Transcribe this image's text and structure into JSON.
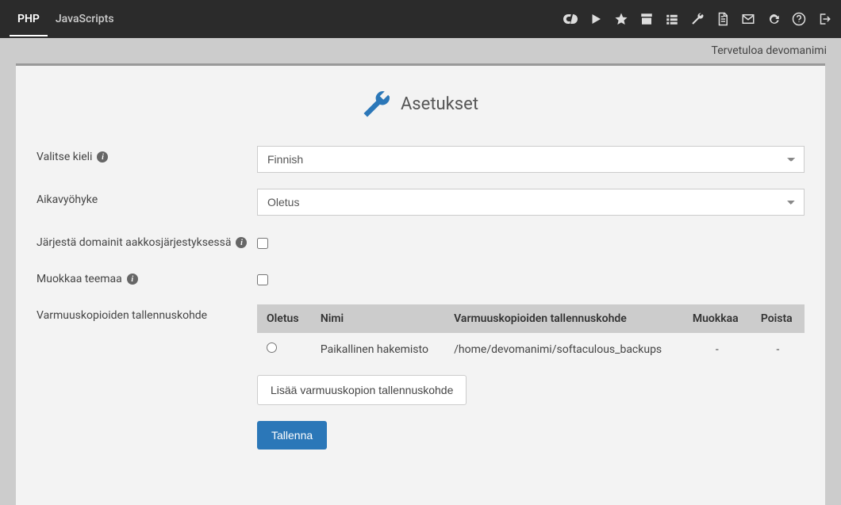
{
  "topbar": {
    "tabs": [
      {
        "label": "PHP",
        "active": true
      },
      {
        "label": "JavaScripts",
        "active": false
      }
    ]
  },
  "welcome": "Tervetuloa devomanimi",
  "page": {
    "title": "Asetukset"
  },
  "form": {
    "language_label": "Valitse kieli",
    "language_value": "Finnish",
    "timezone_label": "Aikavyöhyke",
    "timezone_value": "Oletus",
    "sort_domains_label": "Järjestä domainit aakkosjärjestyksessä",
    "sort_domains_checked": false,
    "edit_theme_label": "Muokkaa teemaa",
    "edit_theme_checked": false,
    "backup_location_label": "Varmuuskopioiden tallennuskohde"
  },
  "backup_table": {
    "headers": {
      "default": "Oletus",
      "name": "Nimi",
      "location": "Varmuuskopioiden tallennuskohde",
      "edit": "Muokkaa",
      "delete": "Poista"
    },
    "rows": [
      {
        "selected": false,
        "name": "Paikallinen hakemisto",
        "location": "/home/devomanimi/softaculous_backups",
        "edit": "-",
        "delete": "-"
      }
    ]
  },
  "buttons": {
    "add_backup": "Lisää varmuuskopion tallennuskohde",
    "save": "Tallenna"
  }
}
